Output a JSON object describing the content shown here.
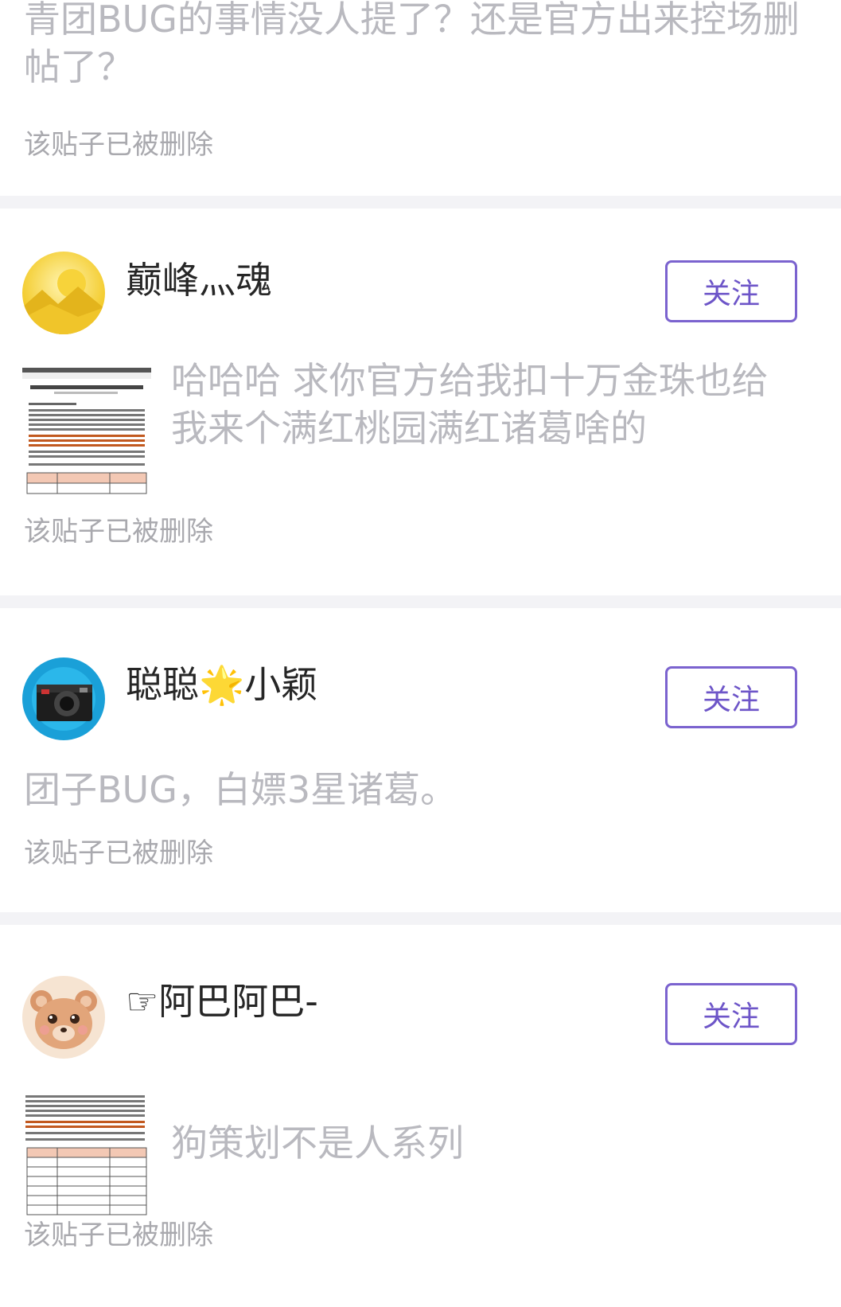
{
  "posts": [
    {
      "title": "青团BUG的事情没人提了？还是官方出来控场删帖了？",
      "deleted_label": "该贴子已被删除"
    },
    {
      "username": "巅峰灬魂",
      "follow_label": "关注",
      "avatar_icon": "desert-sun-avatar",
      "thumbnail_icon": "announcement-document-thumbnail",
      "content": "哈哈哈 求你官方给我扣十万金珠也给我来个满红桃园满红诸葛啥的",
      "deleted_label": "该贴子已被删除"
    },
    {
      "username_prefix": "聪聪",
      "username_emoji": "🌟",
      "username_suffix": "小颖",
      "follow_label": "关注",
      "avatar_icon": "camera-avatar",
      "content": "团子BUG，白嫖3星诸葛。",
      "deleted_label": "该贴子已被删除"
    },
    {
      "username": "☞阿巴阿巴-",
      "follow_label": "关注",
      "avatar_icon": "bear-avatar",
      "thumbnail_icon": "ban-list-table-thumbnail",
      "content": "狗策划不是人系列",
      "deleted_label": "该贴子已被删除"
    }
  ],
  "colors": {
    "accent": "#6d55c8",
    "muted_text": "#b9b9bf",
    "divider": "#f3f3f6"
  }
}
